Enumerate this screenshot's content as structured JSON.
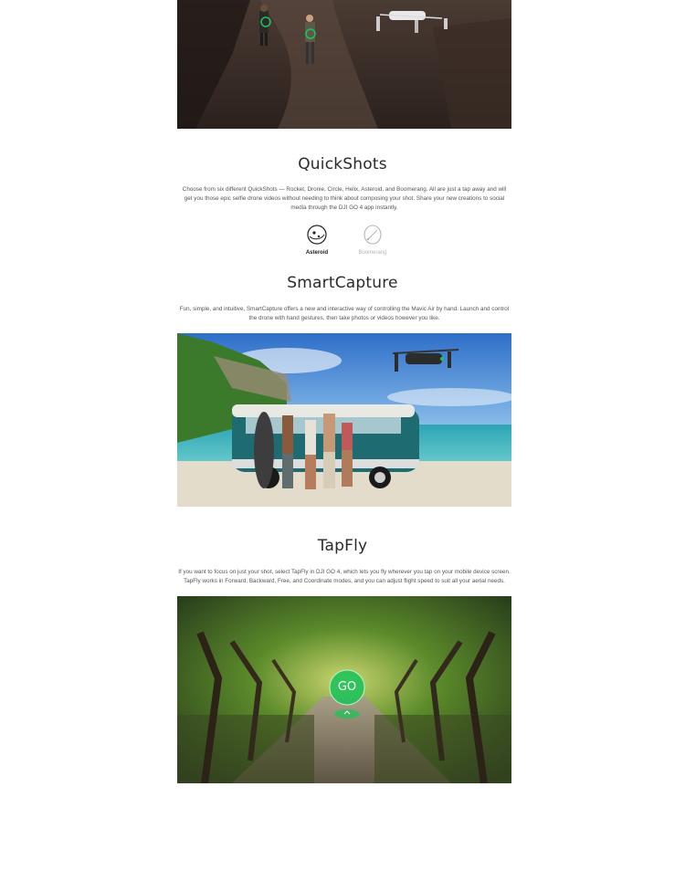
{
  "quickshots": {
    "title": "QuickShots",
    "description": "Choose from six different QuickShots — Rocket, Dronie, Circle, Helix, Asteroid, and Boomerang. All are just a tap away and will get you those epic selfie drone videos without needing to think about composing your shot. Share your new creations to social media through the DJI GO 4 app instantly.",
    "options": [
      {
        "label": "Asteroid",
        "icon": "asteroid-icon",
        "active": true
      },
      {
        "label": "Boomerang",
        "icon": "boomerang-icon",
        "active": false
      }
    ]
  },
  "smartcapture": {
    "title": "SmartCapture",
    "description": "Fun, simple, and intuitive, SmartCapture offers a new and interactive way of controlling the Mavic Air by hand. Launch and control the drone with hand gestures, then take photos or videos however you like."
  },
  "tapfly": {
    "title": "TapFly",
    "description": "If you want to focus on just your shot, select TapFly in DJI GO 4, which lets you fly wherever you tap on your mobile device screen. TapFly works in Forward, Backward, Free, and Coordinate modes, and you can adjust flight speed to suit all your aerial needs.",
    "go_label": "GO"
  },
  "colors": {
    "accent_green": "#21c25a",
    "title_text": "#2a2a2a",
    "body_text": "#555555",
    "inactive_text": "#b5b5b5"
  }
}
